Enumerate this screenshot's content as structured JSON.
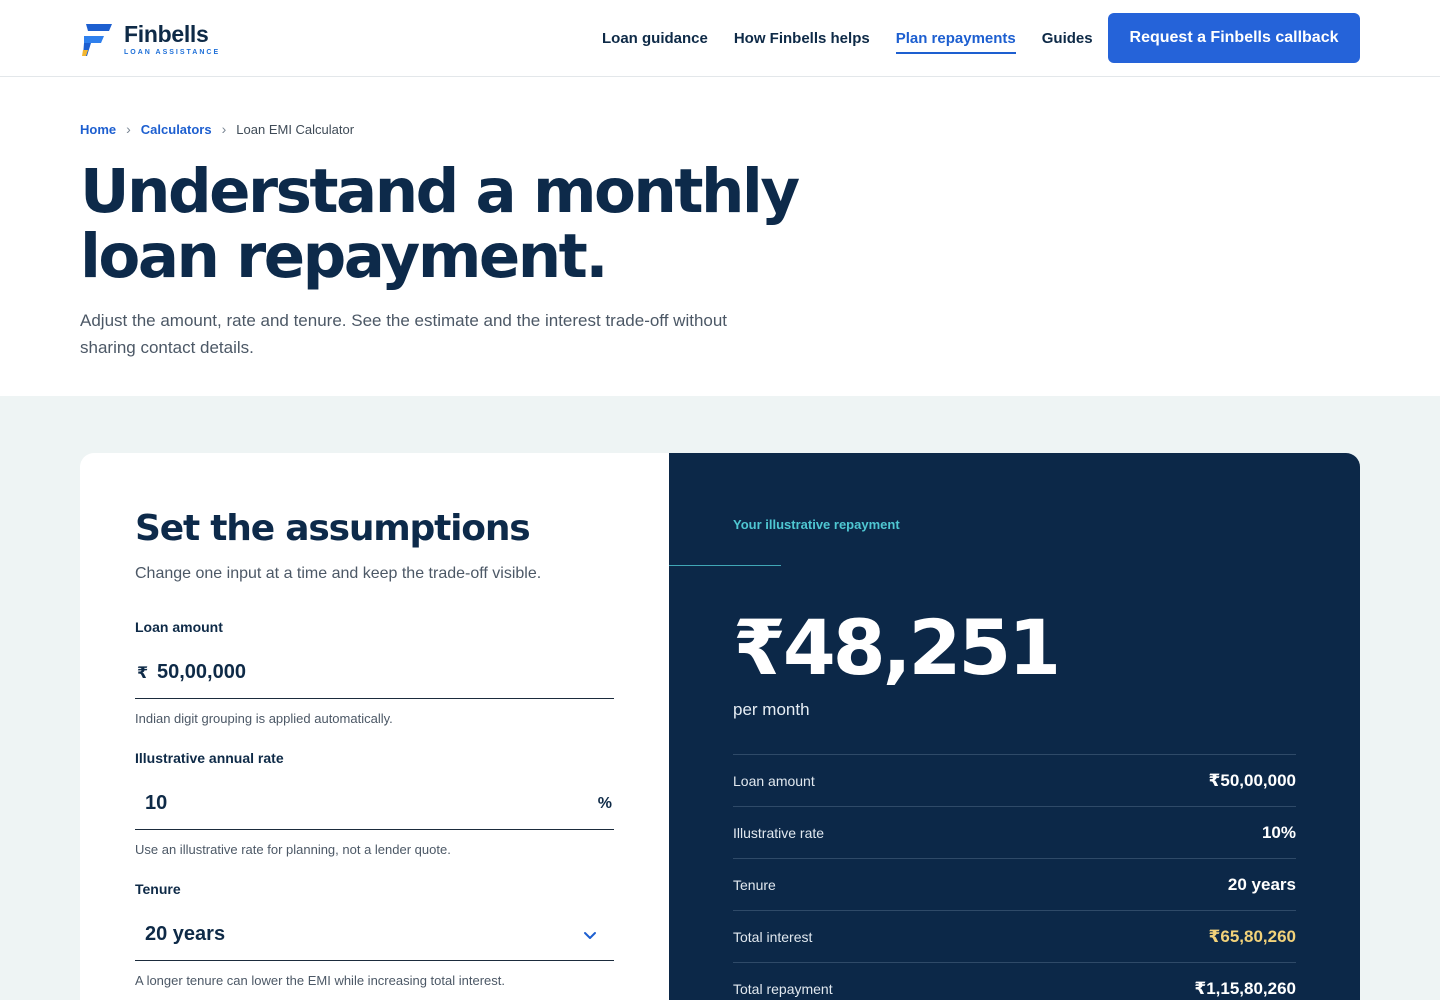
{
  "brand": {
    "name": "Finbells",
    "tagline": "LOAN ASSISTANCE"
  },
  "nav": {
    "items": [
      {
        "label": "Loan guidance",
        "active": false
      },
      {
        "label": "How Finbells helps",
        "active": false
      },
      {
        "label": "Plan repayments",
        "active": true
      },
      {
        "label": "Guides",
        "active": false
      }
    ],
    "cta_label": "Request a Finbells callback"
  },
  "breadcrumb": {
    "home": "Home",
    "calculators": "Calculators",
    "current": "Loan EMI Calculator"
  },
  "hero": {
    "title_line1": "Understand a monthly",
    "title_line2": "loan repayment.",
    "subtitle": "Adjust the amount, rate and tenure. See the estimate and the interest trade-off without sharing contact details."
  },
  "assumptions": {
    "title": "Set the assumptions",
    "subtitle": "Change one input at a time and keep the trade-off visible.",
    "loan_amount": {
      "label": "Loan amount",
      "prefix": "₹",
      "value": "50,00,000",
      "hint": "Indian digit grouping is applied automatically."
    },
    "rate": {
      "label": "Illustrative annual rate",
      "value": "10",
      "suffix": "%",
      "hint": "Use an illustrative rate for planning, not a lender quote."
    },
    "tenure": {
      "label": "Tenure",
      "value": "20 years",
      "hint": "A longer tenure can lower the EMI while increasing total interest."
    }
  },
  "result": {
    "eyebrow": "Your illustrative repayment",
    "emi": "₹48,251",
    "per_month": "per month",
    "rows": [
      {
        "key": "Loan amount",
        "value": "₹50,00,000"
      },
      {
        "key": "Illustrative rate",
        "value": "10%"
      },
      {
        "key": "Tenure",
        "value": "20 years"
      },
      {
        "key": "Total interest",
        "value": "₹65,80,260"
      },
      {
        "key": "Total repayment",
        "value": "₹1,15,80,260"
      }
    ]
  },
  "colors": {
    "navy": "#0c2848",
    "accent_blue": "#2563d9",
    "teal": "#4fc7d2",
    "gold": "#f2d27a",
    "section_bg": "#eef4f4"
  },
  "icons": {
    "logo": "finbells-logo-icon",
    "breadcrumb_sep": "chevron-right-icon",
    "select": "chevron-down-icon"
  }
}
